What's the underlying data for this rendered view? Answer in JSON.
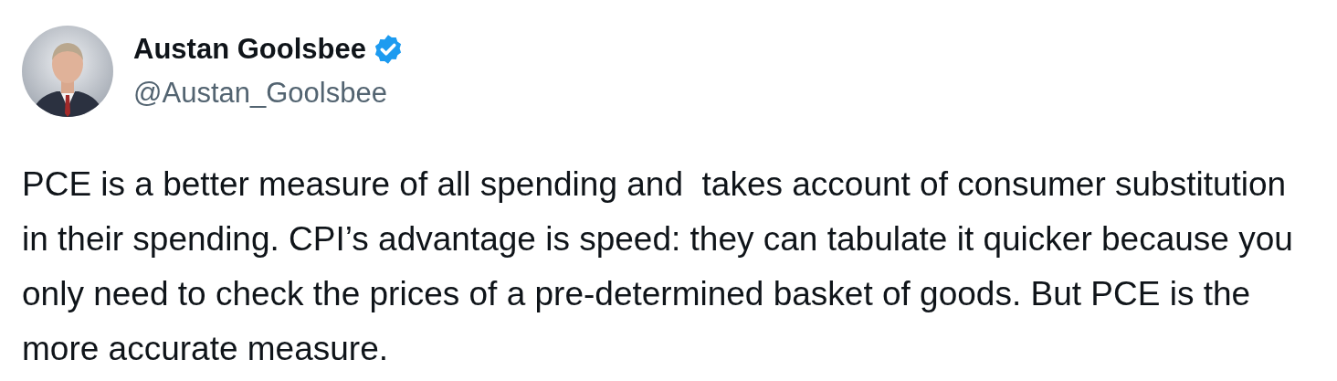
{
  "author": {
    "name": "Austan Goolsbee",
    "verified": true,
    "handle": "@Austan_Goolsbee"
  },
  "post": {
    "text": "PCE is a better measure of all spending and  takes account of consumer substitution in their spending. CPI’s advantage is speed: they can tabulate it quicker because you only need to check the prices of a pre-determined basket of goods. But PCE is the more accurate measure."
  }
}
